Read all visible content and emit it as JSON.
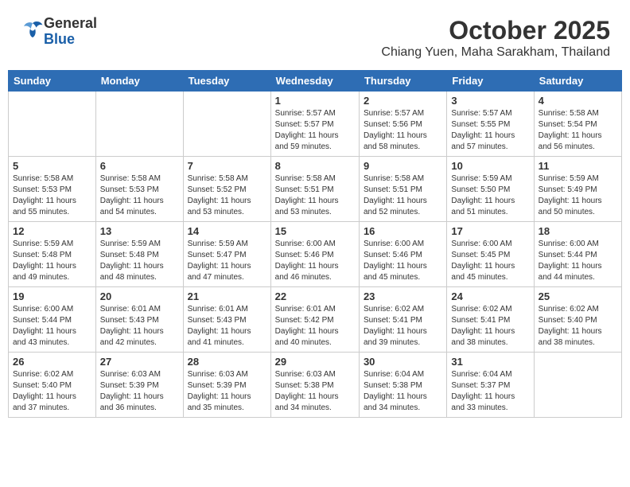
{
  "header": {
    "logo_line1": "General",
    "logo_line2": "Blue",
    "month": "October 2025",
    "location": "Chiang Yuen, Maha Sarakham, Thailand"
  },
  "weekdays": [
    "Sunday",
    "Monday",
    "Tuesday",
    "Wednesday",
    "Thursday",
    "Friday",
    "Saturday"
  ],
  "weeks": [
    [
      {
        "day": "",
        "info": ""
      },
      {
        "day": "",
        "info": ""
      },
      {
        "day": "",
        "info": ""
      },
      {
        "day": "1",
        "info": "Sunrise: 5:57 AM\nSunset: 5:57 PM\nDaylight: 11 hours\nand 59 minutes."
      },
      {
        "day": "2",
        "info": "Sunrise: 5:57 AM\nSunset: 5:56 PM\nDaylight: 11 hours\nand 58 minutes."
      },
      {
        "day": "3",
        "info": "Sunrise: 5:57 AM\nSunset: 5:55 PM\nDaylight: 11 hours\nand 57 minutes."
      },
      {
        "day": "4",
        "info": "Sunrise: 5:58 AM\nSunset: 5:54 PM\nDaylight: 11 hours\nand 56 minutes."
      }
    ],
    [
      {
        "day": "5",
        "info": "Sunrise: 5:58 AM\nSunset: 5:53 PM\nDaylight: 11 hours\nand 55 minutes."
      },
      {
        "day": "6",
        "info": "Sunrise: 5:58 AM\nSunset: 5:53 PM\nDaylight: 11 hours\nand 54 minutes."
      },
      {
        "day": "7",
        "info": "Sunrise: 5:58 AM\nSunset: 5:52 PM\nDaylight: 11 hours\nand 53 minutes."
      },
      {
        "day": "8",
        "info": "Sunrise: 5:58 AM\nSunset: 5:51 PM\nDaylight: 11 hours\nand 53 minutes."
      },
      {
        "day": "9",
        "info": "Sunrise: 5:58 AM\nSunset: 5:51 PM\nDaylight: 11 hours\nand 52 minutes."
      },
      {
        "day": "10",
        "info": "Sunrise: 5:59 AM\nSunset: 5:50 PM\nDaylight: 11 hours\nand 51 minutes."
      },
      {
        "day": "11",
        "info": "Sunrise: 5:59 AM\nSunset: 5:49 PM\nDaylight: 11 hours\nand 50 minutes."
      }
    ],
    [
      {
        "day": "12",
        "info": "Sunrise: 5:59 AM\nSunset: 5:48 PM\nDaylight: 11 hours\nand 49 minutes."
      },
      {
        "day": "13",
        "info": "Sunrise: 5:59 AM\nSunset: 5:48 PM\nDaylight: 11 hours\nand 48 minutes."
      },
      {
        "day": "14",
        "info": "Sunrise: 5:59 AM\nSunset: 5:47 PM\nDaylight: 11 hours\nand 47 minutes."
      },
      {
        "day": "15",
        "info": "Sunrise: 6:00 AM\nSunset: 5:46 PM\nDaylight: 11 hours\nand 46 minutes."
      },
      {
        "day": "16",
        "info": "Sunrise: 6:00 AM\nSunset: 5:46 PM\nDaylight: 11 hours\nand 45 minutes."
      },
      {
        "day": "17",
        "info": "Sunrise: 6:00 AM\nSunset: 5:45 PM\nDaylight: 11 hours\nand 45 minutes."
      },
      {
        "day": "18",
        "info": "Sunrise: 6:00 AM\nSunset: 5:44 PM\nDaylight: 11 hours\nand 44 minutes."
      }
    ],
    [
      {
        "day": "19",
        "info": "Sunrise: 6:00 AM\nSunset: 5:44 PM\nDaylight: 11 hours\nand 43 minutes."
      },
      {
        "day": "20",
        "info": "Sunrise: 6:01 AM\nSunset: 5:43 PM\nDaylight: 11 hours\nand 42 minutes."
      },
      {
        "day": "21",
        "info": "Sunrise: 6:01 AM\nSunset: 5:43 PM\nDaylight: 11 hours\nand 41 minutes."
      },
      {
        "day": "22",
        "info": "Sunrise: 6:01 AM\nSunset: 5:42 PM\nDaylight: 11 hours\nand 40 minutes."
      },
      {
        "day": "23",
        "info": "Sunrise: 6:02 AM\nSunset: 5:41 PM\nDaylight: 11 hours\nand 39 minutes."
      },
      {
        "day": "24",
        "info": "Sunrise: 6:02 AM\nSunset: 5:41 PM\nDaylight: 11 hours\nand 38 minutes."
      },
      {
        "day": "25",
        "info": "Sunrise: 6:02 AM\nSunset: 5:40 PM\nDaylight: 11 hours\nand 38 minutes."
      }
    ],
    [
      {
        "day": "26",
        "info": "Sunrise: 6:02 AM\nSunset: 5:40 PM\nDaylight: 11 hours\nand 37 minutes."
      },
      {
        "day": "27",
        "info": "Sunrise: 6:03 AM\nSunset: 5:39 PM\nDaylight: 11 hours\nand 36 minutes."
      },
      {
        "day": "28",
        "info": "Sunrise: 6:03 AM\nSunset: 5:39 PM\nDaylight: 11 hours\nand 35 minutes."
      },
      {
        "day": "29",
        "info": "Sunrise: 6:03 AM\nSunset: 5:38 PM\nDaylight: 11 hours\nand 34 minutes."
      },
      {
        "day": "30",
        "info": "Sunrise: 6:04 AM\nSunset: 5:38 PM\nDaylight: 11 hours\nand 34 minutes."
      },
      {
        "day": "31",
        "info": "Sunrise: 6:04 AM\nSunset: 5:37 PM\nDaylight: 11 hours\nand 33 minutes."
      },
      {
        "day": "",
        "info": ""
      }
    ]
  ]
}
